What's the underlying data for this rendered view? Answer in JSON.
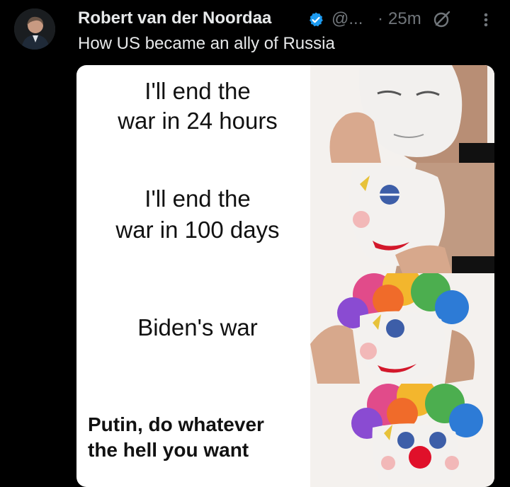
{
  "tweet": {
    "author_name": "Robert van der Noordaa",
    "handle": "@...",
    "separator": "·",
    "time": "25m",
    "text": "How US became an ally of Russia"
  },
  "icons": {
    "verified": "verified-badge-icon",
    "grok": "grok-icon",
    "more": "more-vertical-icon"
  },
  "meme": {
    "panels": [
      {
        "caption_line1": "I'll end the",
        "caption_line2": "war in 24 hours"
      },
      {
        "caption_line1": "I'll end the",
        "caption_line2": "war in 100 days"
      },
      {
        "caption_line1": "Biden's war"
      },
      {
        "caption_line1": "Putin, do whatever",
        "caption_line2": "the hell you want"
      }
    ]
  },
  "colors": {
    "background": "#000000",
    "verified": "#1d9bf0",
    "muted": "#71767b"
  }
}
